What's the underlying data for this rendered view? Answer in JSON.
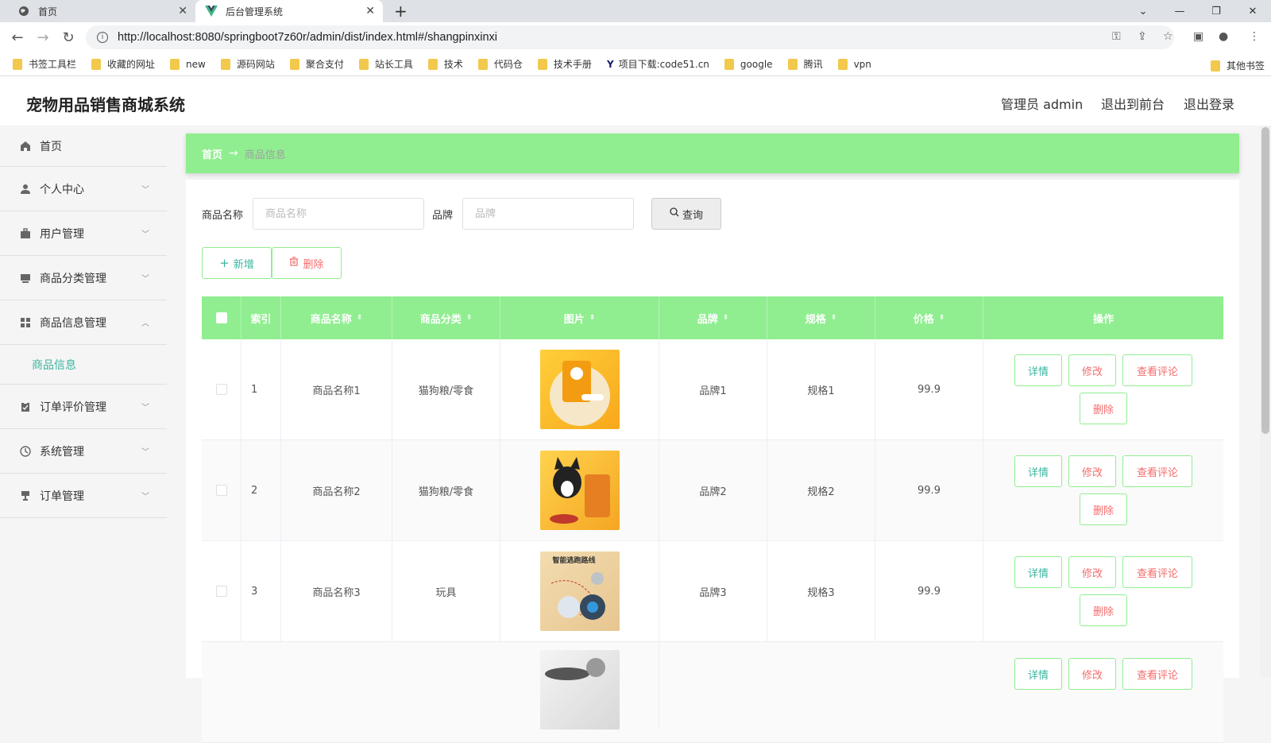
{
  "browser": {
    "tabs": [
      {
        "title": "首页",
        "icon": "globe-icon"
      },
      {
        "title": "后台管理系统",
        "icon": "vue-logo-icon"
      }
    ],
    "url": "http://localhost:8080/springboot7z60r/admin/dist/index.html#/shangpinxinxi",
    "bookmarks": [
      "书签工具栏",
      "收藏的网址",
      "new",
      "源码网站",
      "聚合支付",
      "站长工具",
      "技术",
      "代码仓",
      "技术手册",
      "项目下载:code51.cn",
      "google",
      "腾讯",
      "vpn"
    ],
    "other_bookmarks": "其他书签"
  },
  "header": {
    "title": "宠物用品销售商城系统",
    "admin": "管理员 admin",
    "to_front": "退出到前台",
    "logout": "退出登录"
  },
  "sidebar": {
    "items": [
      {
        "label": "首页",
        "icon": "home-icon"
      },
      {
        "label": "个人中心",
        "icon": "user-icon"
      },
      {
        "label": "用户管理",
        "icon": "briefcase-icon"
      },
      {
        "label": "商品分类管理",
        "icon": "monitor-icon"
      },
      {
        "label": "商品信息管理",
        "icon": "grid-icon"
      },
      {
        "label": "订单评价管理",
        "icon": "clipboard-icon"
      },
      {
        "label": "系统管理",
        "icon": "clock-icon"
      },
      {
        "label": "订单管理",
        "icon": "stand-icon"
      }
    ],
    "active_sub": "商品信息"
  },
  "breadcrumb": {
    "home": "首页",
    "current": "商品信息"
  },
  "search": {
    "name_label": "商品名称",
    "name_placeholder": "商品名称",
    "brand_label": "品牌",
    "brand_placeholder": "品牌",
    "query": "查询"
  },
  "actions": {
    "add": "新增",
    "delete": "删除"
  },
  "table": {
    "headers": [
      "索引",
      "商品名称",
      "商品分类",
      "图片",
      "品牌",
      "规格",
      "价格",
      "操作"
    ],
    "rows": [
      {
        "idx": "1",
        "name": "商品名称1",
        "category": "猫狗粮/零食",
        "brand": "品牌1",
        "spec": "规格1",
        "price": "99.9"
      },
      {
        "idx": "2",
        "name": "商品名称2",
        "category": "猫狗粮/零食",
        "brand": "品牌2",
        "spec": "规格2",
        "price": "99.9"
      },
      {
        "idx": "3",
        "name": "商品名称3",
        "category": "玩具",
        "brand": "品牌3",
        "spec": "规格3",
        "price": "99.9"
      }
    ],
    "img3_caption": "智能逃跑路线",
    "ops": {
      "detail": "详情",
      "edit": "修改",
      "review": "查看评论",
      "delete": "删除"
    }
  },
  "colors": {
    "accent_green": "#90ee90",
    "teal_text": "#3ab5a0",
    "danger_text": "#f56c6c"
  }
}
